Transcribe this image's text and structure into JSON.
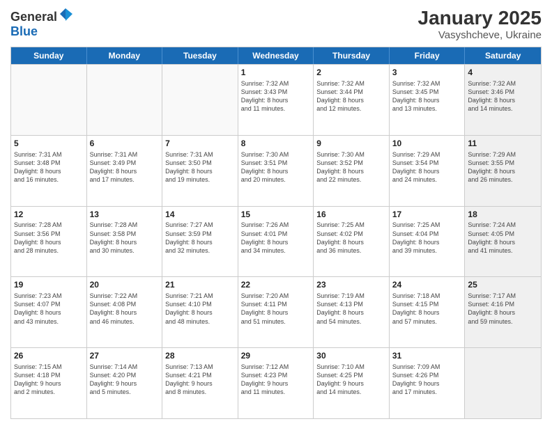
{
  "header": {
    "logo_general": "General",
    "logo_blue": "Blue",
    "month": "January 2025",
    "location": "Vasyshcheve, Ukraine"
  },
  "weekdays": [
    "Sunday",
    "Monday",
    "Tuesday",
    "Wednesday",
    "Thursday",
    "Friday",
    "Saturday"
  ],
  "rows": [
    [
      {
        "day": "",
        "info": "",
        "shaded": false,
        "empty": true
      },
      {
        "day": "",
        "info": "",
        "shaded": false,
        "empty": true
      },
      {
        "day": "",
        "info": "",
        "shaded": false,
        "empty": true
      },
      {
        "day": "1",
        "info": "Sunrise: 7:32 AM\nSunset: 3:43 PM\nDaylight: 8 hours\nand 11 minutes.",
        "shaded": false,
        "empty": false
      },
      {
        "day": "2",
        "info": "Sunrise: 7:32 AM\nSunset: 3:44 PM\nDaylight: 8 hours\nand 12 minutes.",
        "shaded": false,
        "empty": false
      },
      {
        "day": "3",
        "info": "Sunrise: 7:32 AM\nSunset: 3:45 PM\nDaylight: 8 hours\nand 13 minutes.",
        "shaded": false,
        "empty": false
      },
      {
        "day": "4",
        "info": "Sunrise: 7:32 AM\nSunset: 3:46 PM\nDaylight: 8 hours\nand 14 minutes.",
        "shaded": true,
        "empty": false
      }
    ],
    [
      {
        "day": "5",
        "info": "Sunrise: 7:31 AM\nSunset: 3:48 PM\nDaylight: 8 hours\nand 16 minutes.",
        "shaded": false,
        "empty": false
      },
      {
        "day": "6",
        "info": "Sunrise: 7:31 AM\nSunset: 3:49 PM\nDaylight: 8 hours\nand 17 minutes.",
        "shaded": false,
        "empty": false
      },
      {
        "day": "7",
        "info": "Sunrise: 7:31 AM\nSunset: 3:50 PM\nDaylight: 8 hours\nand 19 minutes.",
        "shaded": false,
        "empty": false
      },
      {
        "day": "8",
        "info": "Sunrise: 7:30 AM\nSunset: 3:51 PM\nDaylight: 8 hours\nand 20 minutes.",
        "shaded": false,
        "empty": false
      },
      {
        "day": "9",
        "info": "Sunrise: 7:30 AM\nSunset: 3:52 PM\nDaylight: 8 hours\nand 22 minutes.",
        "shaded": false,
        "empty": false
      },
      {
        "day": "10",
        "info": "Sunrise: 7:29 AM\nSunset: 3:54 PM\nDaylight: 8 hours\nand 24 minutes.",
        "shaded": false,
        "empty": false
      },
      {
        "day": "11",
        "info": "Sunrise: 7:29 AM\nSunset: 3:55 PM\nDaylight: 8 hours\nand 26 minutes.",
        "shaded": true,
        "empty": false
      }
    ],
    [
      {
        "day": "12",
        "info": "Sunrise: 7:28 AM\nSunset: 3:56 PM\nDaylight: 8 hours\nand 28 minutes.",
        "shaded": false,
        "empty": false
      },
      {
        "day": "13",
        "info": "Sunrise: 7:28 AM\nSunset: 3:58 PM\nDaylight: 8 hours\nand 30 minutes.",
        "shaded": false,
        "empty": false
      },
      {
        "day": "14",
        "info": "Sunrise: 7:27 AM\nSunset: 3:59 PM\nDaylight: 8 hours\nand 32 minutes.",
        "shaded": false,
        "empty": false
      },
      {
        "day": "15",
        "info": "Sunrise: 7:26 AM\nSunset: 4:01 PM\nDaylight: 8 hours\nand 34 minutes.",
        "shaded": false,
        "empty": false
      },
      {
        "day": "16",
        "info": "Sunrise: 7:25 AM\nSunset: 4:02 PM\nDaylight: 8 hours\nand 36 minutes.",
        "shaded": false,
        "empty": false
      },
      {
        "day": "17",
        "info": "Sunrise: 7:25 AM\nSunset: 4:04 PM\nDaylight: 8 hours\nand 39 minutes.",
        "shaded": false,
        "empty": false
      },
      {
        "day": "18",
        "info": "Sunrise: 7:24 AM\nSunset: 4:05 PM\nDaylight: 8 hours\nand 41 minutes.",
        "shaded": true,
        "empty": false
      }
    ],
    [
      {
        "day": "19",
        "info": "Sunrise: 7:23 AM\nSunset: 4:07 PM\nDaylight: 8 hours\nand 43 minutes.",
        "shaded": false,
        "empty": false
      },
      {
        "day": "20",
        "info": "Sunrise: 7:22 AM\nSunset: 4:08 PM\nDaylight: 8 hours\nand 46 minutes.",
        "shaded": false,
        "empty": false
      },
      {
        "day": "21",
        "info": "Sunrise: 7:21 AM\nSunset: 4:10 PM\nDaylight: 8 hours\nand 48 minutes.",
        "shaded": false,
        "empty": false
      },
      {
        "day": "22",
        "info": "Sunrise: 7:20 AM\nSunset: 4:11 PM\nDaylight: 8 hours\nand 51 minutes.",
        "shaded": false,
        "empty": false
      },
      {
        "day": "23",
        "info": "Sunrise: 7:19 AM\nSunset: 4:13 PM\nDaylight: 8 hours\nand 54 minutes.",
        "shaded": false,
        "empty": false
      },
      {
        "day": "24",
        "info": "Sunrise: 7:18 AM\nSunset: 4:15 PM\nDaylight: 8 hours\nand 57 minutes.",
        "shaded": false,
        "empty": false
      },
      {
        "day": "25",
        "info": "Sunrise: 7:17 AM\nSunset: 4:16 PM\nDaylight: 8 hours\nand 59 minutes.",
        "shaded": true,
        "empty": false
      }
    ],
    [
      {
        "day": "26",
        "info": "Sunrise: 7:15 AM\nSunset: 4:18 PM\nDaylight: 9 hours\nand 2 minutes.",
        "shaded": false,
        "empty": false
      },
      {
        "day": "27",
        "info": "Sunrise: 7:14 AM\nSunset: 4:20 PM\nDaylight: 9 hours\nand 5 minutes.",
        "shaded": false,
        "empty": false
      },
      {
        "day": "28",
        "info": "Sunrise: 7:13 AM\nSunset: 4:21 PM\nDaylight: 9 hours\nand 8 minutes.",
        "shaded": false,
        "empty": false
      },
      {
        "day": "29",
        "info": "Sunrise: 7:12 AM\nSunset: 4:23 PM\nDaylight: 9 hours\nand 11 minutes.",
        "shaded": false,
        "empty": false
      },
      {
        "day": "30",
        "info": "Sunrise: 7:10 AM\nSunset: 4:25 PM\nDaylight: 9 hours\nand 14 minutes.",
        "shaded": false,
        "empty": false
      },
      {
        "day": "31",
        "info": "Sunrise: 7:09 AM\nSunset: 4:26 PM\nDaylight: 9 hours\nand 17 minutes.",
        "shaded": false,
        "empty": false
      },
      {
        "day": "",
        "info": "",
        "shaded": true,
        "empty": true
      }
    ]
  ]
}
